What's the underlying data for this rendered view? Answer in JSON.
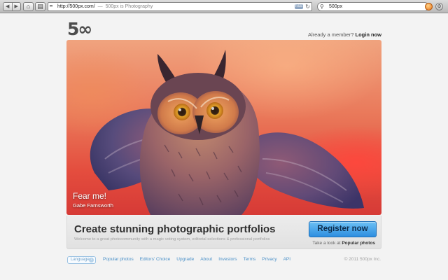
{
  "browser": {
    "nav_back": "◀",
    "nav_forward": "▶",
    "url": "http://500px.com/",
    "separator": "—",
    "page_title": "500px is Photography",
    "rss_label": "RSS",
    "search_value": "500px"
  },
  "header": {
    "logo_text": "5∞",
    "member_prompt": "Already a member?",
    "login_label": "Login now"
  },
  "hero": {
    "photo_title": "Fear me!",
    "photo_author": "Gabe Farnsworth"
  },
  "cta": {
    "headline": "Create stunning photographic portfolios",
    "subtext": "Welcome to a great photocommunity with a magic voting system, editorial selections & professional portfolios",
    "register_label": "Register now",
    "popular_prefix": "Take a look at",
    "popular_link": "Popular photos"
  },
  "footer": {
    "language_label": "Language",
    "links": [
      "Popular photos",
      "Editors' Choice",
      "Upgrade",
      "About",
      "Investors",
      "Terms",
      "Privacy",
      "API"
    ],
    "copyright": "© 2011 500px Inc."
  },
  "colors": {
    "register_button": "#3d9de8",
    "link": "#4a90c8",
    "hero_background": "#e76a4f"
  }
}
